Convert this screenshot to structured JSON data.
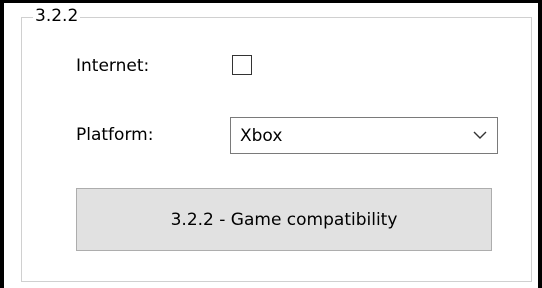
{
  "group": {
    "caption": "3.2.2"
  },
  "form": {
    "internet_label": "Internet:",
    "internet_checked": false,
    "platform_label": "Platform:",
    "platform_value": "Xbox"
  },
  "action": {
    "button_label": "3.2.2 - Game compatibility"
  },
  "icons": {
    "dropdown": "chevron-down-icon"
  },
  "colors": {
    "button_bg": "#e1e1e1",
    "group_border": "#d0d0d0"
  }
}
